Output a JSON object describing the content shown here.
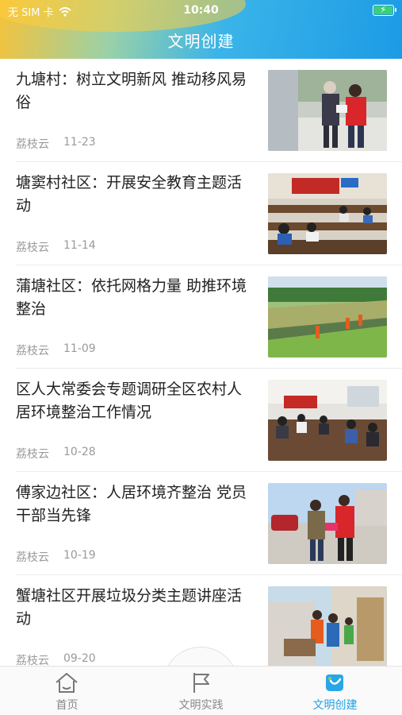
{
  "status_bar": {
    "carrier": "无 SIM 卡",
    "time": "10:40"
  },
  "header": {
    "title": "文明创建"
  },
  "news": [
    {
      "title": "九塘村：树立文明新风 推动移风易俗",
      "source": "荔枝云",
      "date": "11-23"
    },
    {
      "title": "塘窦村社区：开展安全教育主题活动",
      "source": "荔枝云",
      "date": "11-14"
    },
    {
      "title": "蒲塘社区：依托网格力量 助推环境整治",
      "source": "荔枝云",
      "date": "11-09"
    },
    {
      "title": "区人大常委会专题调研全区农村人居环境整治工作情况",
      "source": "荔枝云",
      "date": "10-28"
    },
    {
      "title": "傅家边社区：人居环境齐整治 党员干部当先锋",
      "source": "荔枝云",
      "date": "10-19"
    },
    {
      "title": "蟹塘社区开展垃圾分类主题讲座活动",
      "source": "荔枝云",
      "date": "09-20"
    }
  ],
  "tabbar": {
    "items": [
      {
        "label": "首页",
        "icon": "home-icon"
      },
      {
        "label": "文明实践",
        "icon": "flag-icon"
      },
      {
        "label": "文明创建",
        "icon": "civilization-icon"
      }
    ],
    "active_index": 2,
    "active_color": "#1ea1e8",
    "inactive_color": "#888888"
  }
}
